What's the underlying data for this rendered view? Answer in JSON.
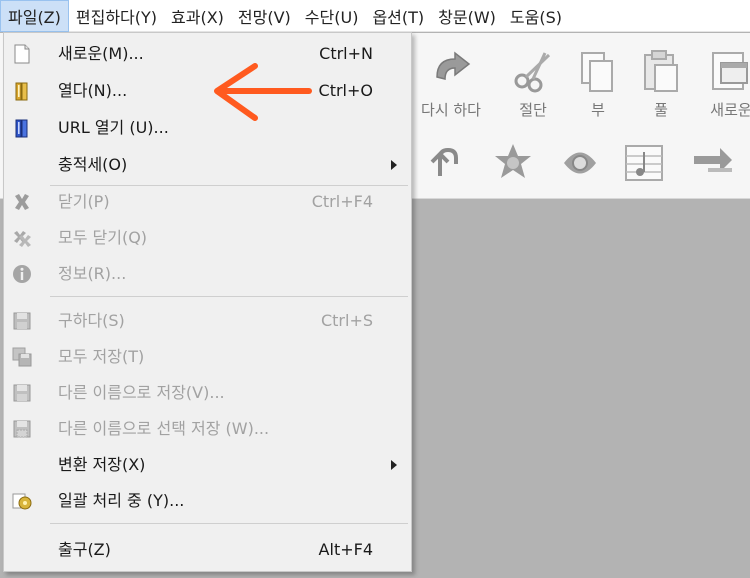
{
  "menubar": {
    "items": [
      {
        "label": "파일(Z)",
        "active": true
      },
      {
        "label": "편집하다(Y)"
      },
      {
        "label": "효과(X)"
      },
      {
        "label": "전망(V)"
      },
      {
        "label": "수단(U)"
      },
      {
        "label": "옵션(T)"
      },
      {
        "label": "창문(W)"
      },
      {
        "label": "도움(S)"
      }
    ]
  },
  "toolbar": {
    "buttons": [
      {
        "label": "다시 하다",
        "icon": "redo-icon"
      },
      {
        "label": "절단",
        "icon": "scissors-icon"
      },
      {
        "label": "부",
        "icon": "copy-icon"
      },
      {
        "label": "풀",
        "icon": "paste-icon"
      },
      {
        "label": "새로운",
        "icon": "new-window-icon"
      }
    ]
  },
  "file_menu": {
    "new": {
      "label": "새로운(M)...",
      "shortcut": "Ctrl+N"
    },
    "open": {
      "label": "열다(N)...",
      "shortcut": "Ctrl+O"
    },
    "open_url": {
      "label": "URL 열기 (U)..."
    },
    "recent": {
      "label": "충적세(O)"
    },
    "close": {
      "label": "닫기(P)",
      "shortcut": "Ctrl+F4"
    },
    "close_all": {
      "label": "모두 닫기(Q)"
    },
    "info": {
      "label": "정보(R)..."
    },
    "save": {
      "label": "구하다(S)",
      "shortcut": "Ctrl+S"
    },
    "save_all": {
      "label": "모두 저장(T)"
    },
    "save_as": {
      "label": "다른 이름으로 저장(V)..."
    },
    "save_selection_as": {
      "label": "다른 이름으로 선택 저장 (W)..."
    },
    "convert_save": {
      "label": "변환 저장(X)"
    },
    "batch": {
      "label": "일괄 처리 중 (Y)..."
    },
    "exit": {
      "label": "출구(Z)",
      "shortcut": "Alt+F4"
    }
  },
  "colors": {
    "annotation_arrow": "#ff5a1f",
    "menu_bg": "#f0f0f0",
    "menubar_active": "#cce0f7"
  }
}
